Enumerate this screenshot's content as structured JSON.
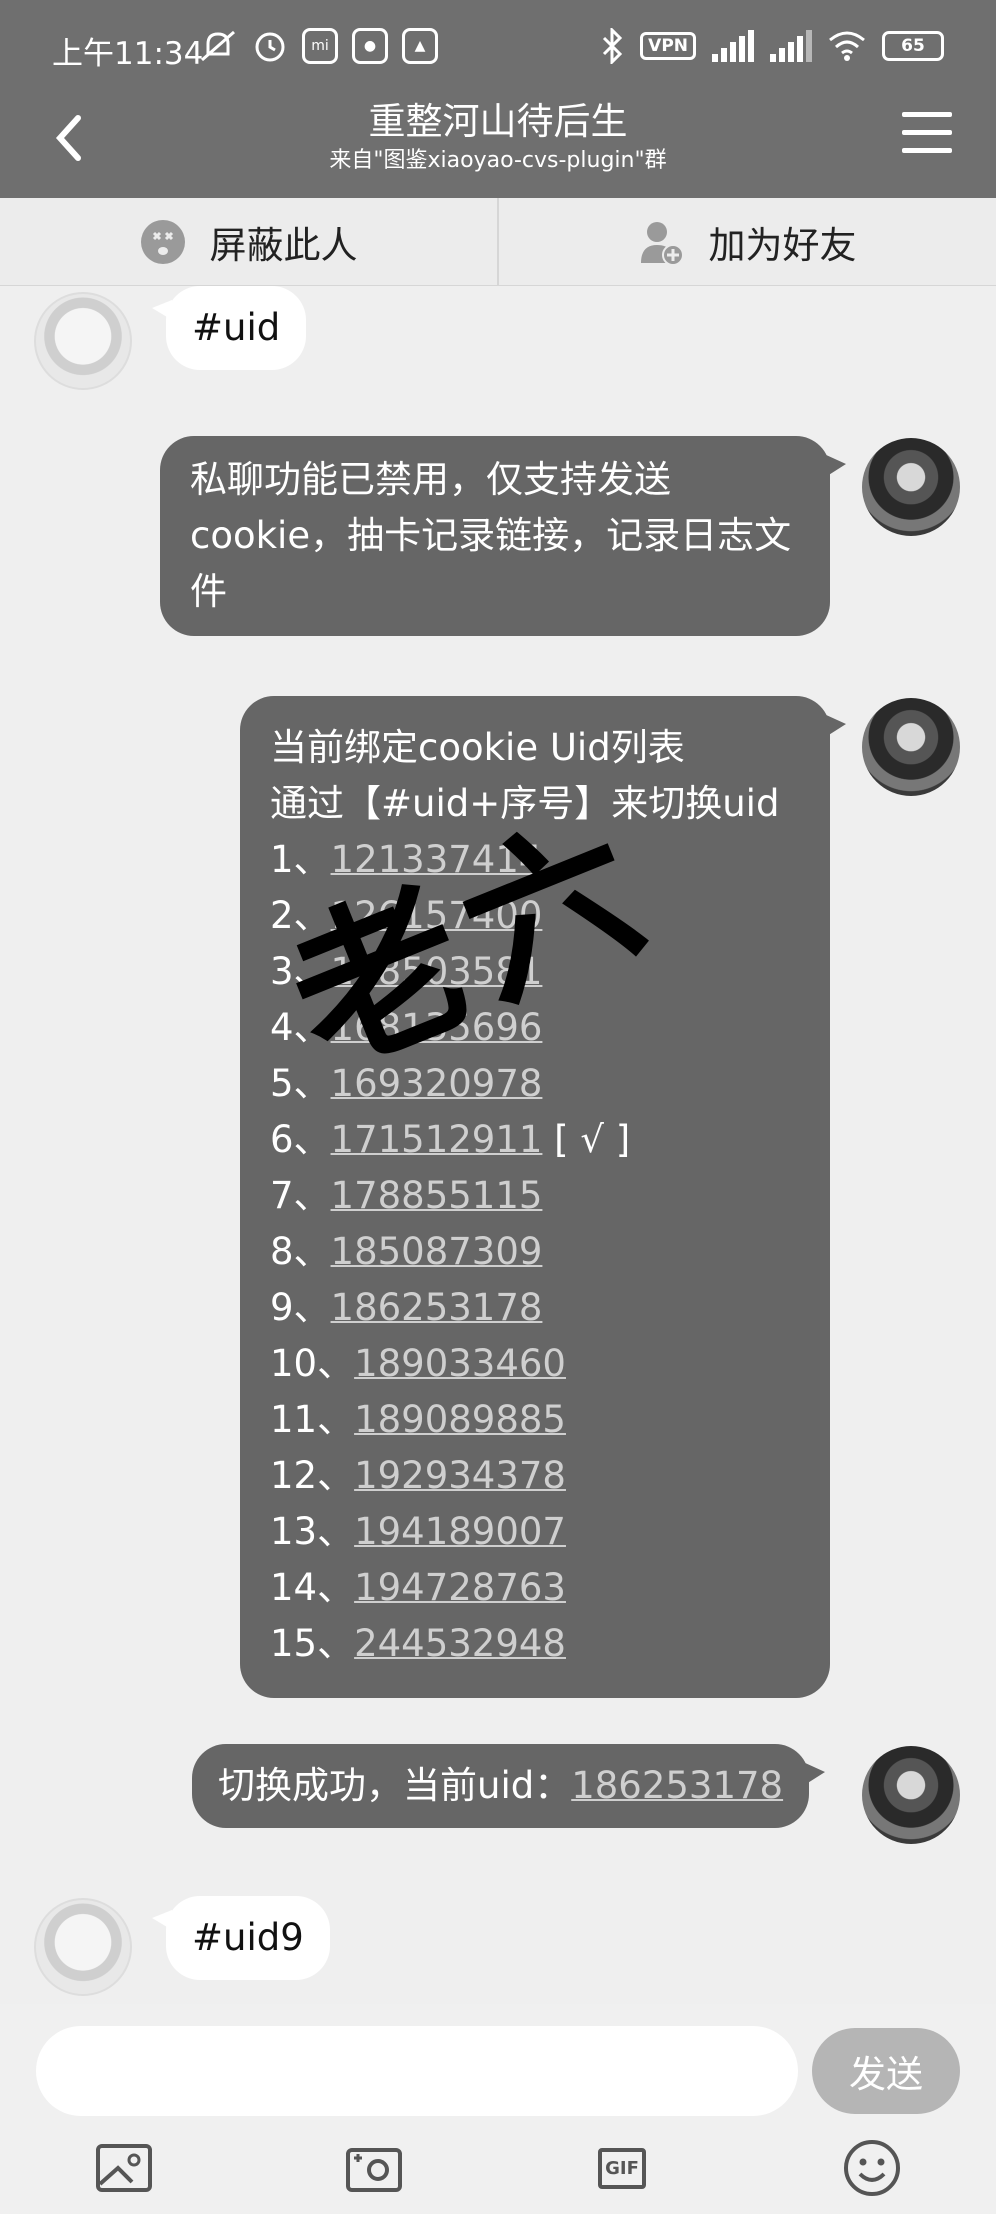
{
  "status": {
    "time": "上午11:34",
    "mi_label": "mi",
    "vpn": "VPN",
    "battery": "65"
  },
  "header": {
    "title": "重整河山待后生",
    "subtitle": "来自\"图鉴xiaoyao-cvs-plugin\"群"
  },
  "actions": {
    "block": "屏蔽此人",
    "add_friend": "加为好友"
  },
  "messages": {
    "m1": "#uid",
    "m2": "私聊功能已禁用，仅支持发送cookie，抽卡记录链接，记录日志文件",
    "m3_line1": "当前绑定cookie Uid列表",
    "m3_line2": "通过【#uid+序号】来切换uid",
    "uid_list": [
      {
        "prefix": "1、",
        "uid": "121337414",
        "mark": ""
      },
      {
        "prefix": "2、",
        "uid": "126157400",
        "mark": ""
      },
      {
        "prefix": "3、",
        "uid": "128503581",
        "mark": ""
      },
      {
        "prefix": "4、",
        "uid": "168135696",
        "mark": ""
      },
      {
        "prefix": "5、",
        "uid": "169320978",
        "mark": ""
      },
      {
        "prefix": "6、",
        "uid": "171512911",
        "mark": " [ √ ]"
      },
      {
        "prefix": "7、",
        "uid": "178855115",
        "mark": ""
      },
      {
        "prefix": "8、",
        "uid": "185087309",
        "mark": ""
      },
      {
        "prefix": "9、",
        "uid": "186253178",
        "mark": ""
      },
      {
        "prefix": "10、",
        "uid": "189033460",
        "mark": ""
      },
      {
        "prefix": "11、",
        "uid": "189089885",
        "mark": ""
      },
      {
        "prefix": "12、",
        "uid": "192934378",
        "mark": ""
      },
      {
        "prefix": "13、",
        "uid": "194189007",
        "mark": ""
      },
      {
        "prefix": "14、",
        "uid": "194728763",
        "mark": ""
      },
      {
        "prefix": "15、",
        "uid": "244532948",
        "mark": ""
      }
    ],
    "m4_prefix": "切换成功，当前uid：",
    "m4_uid": "186253178",
    "m5": "#uid9",
    "watermark": "老六"
  },
  "input": {
    "placeholder": "",
    "send_label": "发送",
    "gif_label": "GIF"
  },
  "colors": {
    "header_bg": "#6f6f6f",
    "outgoing_bubble": "#666666",
    "incoming_bubble": "#ffffff",
    "link": "#cfcfcf",
    "send_button": "#b5b5b5"
  }
}
